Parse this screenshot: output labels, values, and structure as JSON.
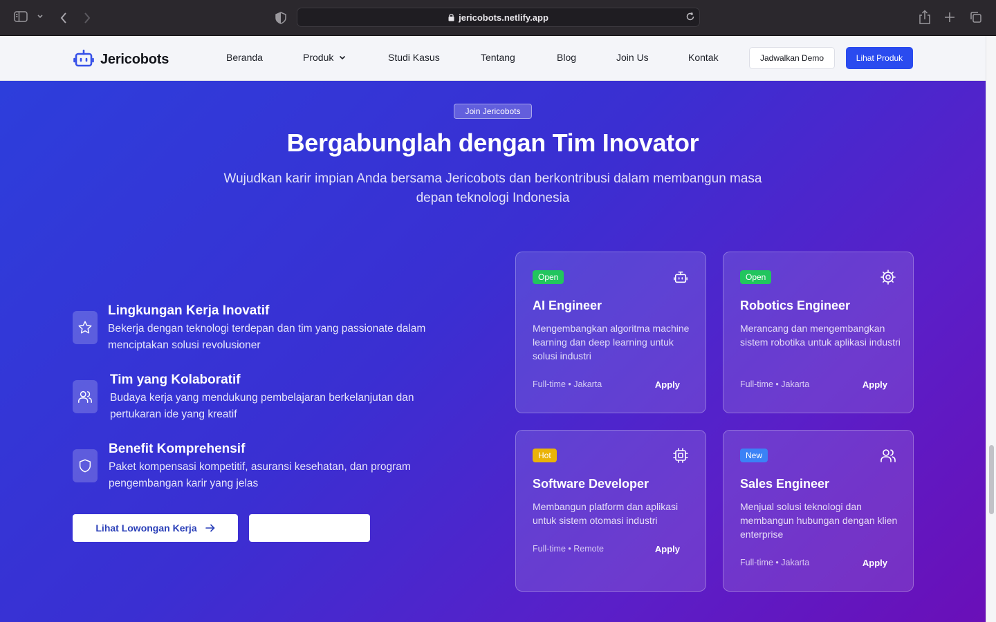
{
  "browser": {
    "url": "jericobots.netlify.app"
  },
  "nav": {
    "brand": "Jericobots",
    "links": [
      "Beranda",
      "Produk",
      "Studi Kasus",
      "Tentang",
      "Blog",
      "Join Us",
      "Kontak"
    ],
    "demo_button": "Jadwalkan Demo",
    "product_button": "Lihat Produk"
  },
  "hero": {
    "badge": "Join Jericobots",
    "title": "Bergabunglah dengan Tim Inovator",
    "subtitle": "Wujudkan karir impian Anda bersama Jericobots dan berkontribusi dalam membangun masa depan teknologi Indonesia"
  },
  "features": [
    {
      "title": "Lingkungan Kerja Inovatif",
      "desc": "Bekerja dengan teknologi terdepan dan tim yang passionate dalam menciptakan solusi revolusioner",
      "icon": "star-icon"
    },
    {
      "title": "Tim yang Kolaboratif",
      "desc": "Budaya kerja yang mendukung pembelajaran berkelanjutan dan pertukaran ide yang kreatif",
      "icon": "users-icon"
    },
    {
      "title": "Benefit Komprehensif",
      "desc": "Paket kompensasi kompetitif, asuransi kesehatan, dan program pengembangan karir yang jelas",
      "icon": "shield-icon"
    }
  ],
  "cta": {
    "jobs_button": "Lihat Lowongan Kerja"
  },
  "jobs": [
    {
      "tag": "Open",
      "tag_color": "#22c55e",
      "title": "AI Engineer",
      "desc": "Mengembangkan algoritma machine learning dan deep learning untuk solusi industri",
      "meta": "Full-time • Jakarta",
      "apply": "Apply",
      "icon": "bot-icon"
    },
    {
      "tag": "Open",
      "tag_color": "#22c55e",
      "title": "Robotics Engineer",
      "desc": "Merancang dan mengembangkan sistem robotika untuk aplikasi industri",
      "meta": "Full-time • Jakarta",
      "apply": "Apply",
      "icon": "cog-icon"
    },
    {
      "tag": "Hot",
      "tag_color": "#eab308",
      "title": "Software Developer",
      "desc": "Membangun platform dan aplikasi untuk sistem otomasi industri",
      "meta": "Full-time • Remote",
      "apply": "Apply",
      "icon": "cpu-icon"
    },
    {
      "tag": "New",
      "tag_color": "#3b82f6",
      "title": "Sales Engineer",
      "desc": "Menjual solusi teknologi dan membangun hubungan dengan klien enterprise",
      "meta": "Full-time • Jakarta",
      "apply": "Apply",
      "icon": "users-icon"
    }
  ]
}
